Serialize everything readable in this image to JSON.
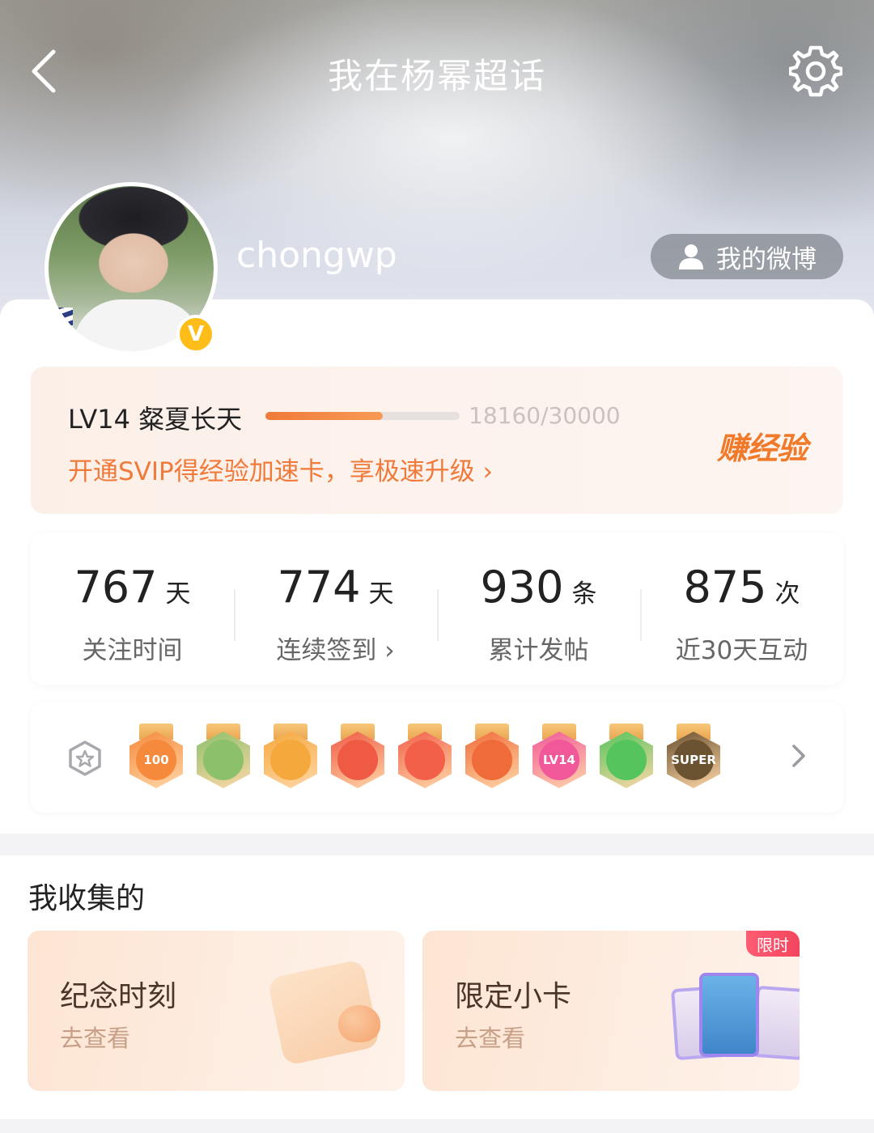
{
  "header": {
    "title": "我在杨幂超话",
    "back_icon": "chevron-left-icon",
    "settings_icon": "gear-icon"
  },
  "profile": {
    "username": "chongwp",
    "vip_badge": "V",
    "my_weibo_label": "我的微博",
    "my_weibo_icon": "person-icon"
  },
  "level": {
    "name": "LV14 粲夏长天",
    "exp_text": "18160/30000",
    "progress": 0.6053,
    "svip_link": "开通SVIP得经验加速卡，享极速升级 ›",
    "earn_label": "赚经验"
  },
  "stats": [
    {
      "value": "767",
      "unit": "天",
      "label": "关注时间"
    },
    {
      "value": "774",
      "unit": "天",
      "label": "连续签到 ›"
    },
    {
      "value": "930",
      "unit": "条",
      "label": "累计发帖"
    },
    {
      "value": "875",
      "unit": "次",
      "label": "近30天互动"
    }
  ],
  "badges": {
    "hub_icon": "badge-hub-icon",
    "items": [
      {
        "name": "100-days-badge",
        "text": "100",
        "color": "#f58a3c"
      },
      {
        "name": "cartoon-girl-badge",
        "text": "",
        "color": "#8cc06a"
      },
      {
        "name": "crown-badge",
        "text": "",
        "color": "#f5a83c"
      },
      {
        "name": "cat-badge-1",
        "text": "",
        "color": "#ef5a45"
      },
      {
        "name": "cat-badge-2",
        "text": "",
        "color": "#f2604a"
      },
      {
        "name": "dragon-badge",
        "text": "",
        "color": "#f06b3a"
      },
      {
        "name": "lv14-badge",
        "text": "LV14",
        "color": "#f0589a"
      },
      {
        "name": "hand-badge",
        "text": "",
        "color": "#55c45c"
      },
      {
        "name": "super-badge",
        "text": "SUPER",
        "color": "#6b5230"
      }
    ],
    "more_icon": "chevron-right-icon"
  },
  "collection": {
    "title": "我收集的",
    "cards": [
      {
        "title": "纪念时刻",
        "sub": "去查看"
      },
      {
        "title": "限定小卡",
        "sub": "去查看",
        "tag": "限时"
      }
    ]
  }
}
